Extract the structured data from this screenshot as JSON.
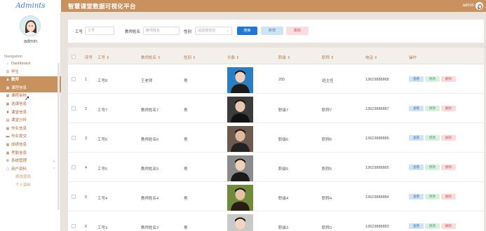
{
  "app": {
    "logo": "Admints",
    "title": "智慧课堂数据可视化平台"
  },
  "header": {
    "username": "admin"
  },
  "sidebar": {
    "username": "admin",
    "caption": "Navigation",
    "items": [
      {
        "label": "Dashboard",
        "icon": "home-icon",
        "glyph": "⌂"
      },
      {
        "label": "学生",
        "icon": "user-icon",
        "glyph": "☰"
      },
      {
        "label": "教师",
        "icon": "user-icon",
        "glyph": "♟"
      },
      {
        "label": "课程信息",
        "icon": "grid-icon",
        "glyph": "▦"
      },
      {
        "label": "课程审核",
        "icon": "grid-icon",
        "glyph": "▦"
      },
      {
        "label": "选课信息",
        "icon": "grid-icon",
        "glyph": "▦"
      },
      {
        "label": "课堂信息",
        "icon": "trophy-icon",
        "glyph": "♜"
      },
      {
        "label": "课堂分析",
        "icon": "calendar-icon",
        "glyph": "▤"
      },
      {
        "label": "作业信息",
        "icon": "grid-icon",
        "glyph": "▦"
      },
      {
        "label": "作业提交",
        "icon": "folder-icon",
        "glyph": "▬"
      },
      {
        "label": "成绩信息",
        "icon": "grid-icon",
        "glyph": "▦"
      },
      {
        "label": "考勤信息",
        "icon": "grid-icon",
        "glyph": "▦"
      },
      {
        "label": "系统管理",
        "icon": "gear-icon",
        "glyph": "⚙"
      },
      {
        "label": "用户资料",
        "icon": "doc-icon",
        "glyph": "▢"
      },
      {
        "label": "修改密码",
        "icon": "",
        "glyph": ""
      },
      {
        "label": "个人资料",
        "icon": "",
        "glyph": ""
      }
    ]
  },
  "search": {
    "field1_label": "工号",
    "field1_placeholder": "工号",
    "field2_label": "教师姓名",
    "field2_placeholder": "教师姓名",
    "field3_label": "性别",
    "field3_placeholder": "请选择性别",
    "search_button": "搜索",
    "add_button": "新增",
    "delete_button": "删除"
  },
  "table": {
    "columns": [
      "序号",
      "工号 ⇕",
      "教师姓名 ⇕",
      "性别 ⇕",
      "头像 ⇕",
      "职级 ⇕",
      "职称 ⇕",
      "电话 ⇕",
      "操作"
    ],
    "actions": {
      "detail": "查看",
      "edit": "修改",
      "delete": "删除"
    },
    "rows": [
      {
        "no": "1",
        "id": "工号8",
        "name": "王老师",
        "gender": "男",
        "rank": "205",
        "title": "班主任",
        "phone": "13623888888"
      },
      {
        "no": "2",
        "id": "工号7",
        "name": "教师姓名7",
        "gender": "男",
        "rank": "职级7",
        "title": "职称7",
        "phone": "13623888887"
      },
      {
        "no": "3",
        "id": "工号6",
        "name": "教师姓名6",
        "gender": "男",
        "rank": "职级6",
        "title": "职称6",
        "phone": "13623888886"
      },
      {
        "no": "4",
        "id": "工号5",
        "name": "教师姓名5",
        "gender": "男",
        "rank": "职级5",
        "title": "职称5",
        "phone": "13623888885"
      },
      {
        "no": "5",
        "id": "工号4",
        "name": "教师姓名4",
        "gender": "男",
        "rank": "职级4",
        "title": "职称4",
        "phone": "13623888884"
      },
      {
        "no": "6",
        "id": "工号3",
        "name": "教师姓名3",
        "gender": "男",
        "rank": "职级3",
        "title": "职称3",
        "phone": "13623888883"
      }
    ]
  },
  "colors": {
    "accent": "#c9915e",
    "primary": "#1f77d6"
  }
}
